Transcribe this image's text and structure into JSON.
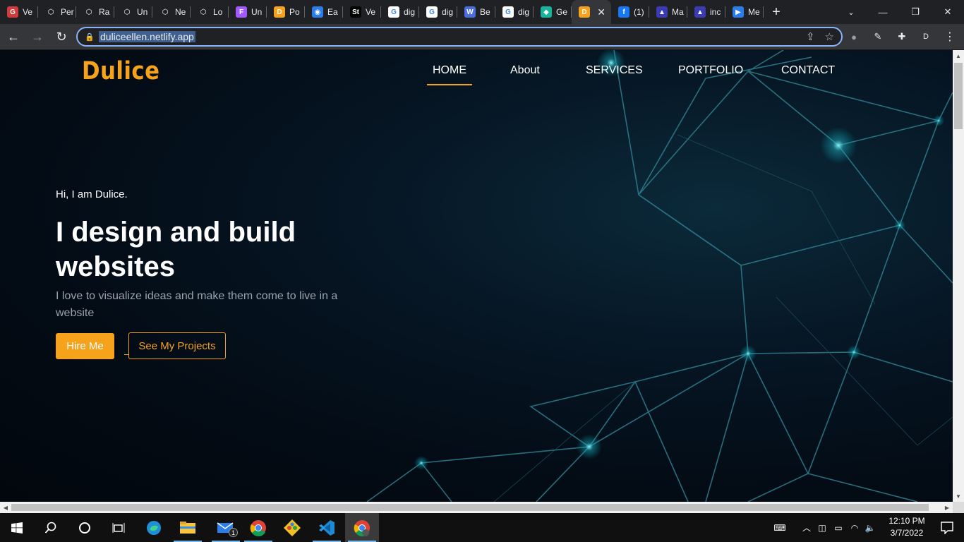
{
  "browser": {
    "tabs": [
      {
        "label": "Ve",
        "icon": "grammarly-icon",
        "color": "#d23b3b",
        "glyph": "G"
      },
      {
        "label": "Per",
        "icon": "codepen-icon",
        "color": "#202124",
        "glyph": "⬡"
      },
      {
        "label": "Ra",
        "icon": "codepen-icon",
        "color": "#202124",
        "glyph": "⬡"
      },
      {
        "label": "Un",
        "icon": "codepen-icon",
        "color": "#202124",
        "glyph": "⬡"
      },
      {
        "label": "Ne",
        "icon": "codepen-icon",
        "color": "#202124",
        "glyph": "⬡"
      },
      {
        "label": "Lo",
        "icon": "codepen-icon",
        "color": "#202124",
        "glyph": "⬡"
      },
      {
        "label": "Un",
        "icon": "figma-icon",
        "color": "#a259ff",
        "glyph": "F"
      },
      {
        "label": "Po",
        "icon": "portfolio-icon",
        "color": "#f7a21b",
        "glyph": "D"
      },
      {
        "label": "Ea",
        "icon": "bug-icon",
        "color": "#2b7de9",
        "glyph": "◉"
      },
      {
        "label": "Ve",
        "icon": "st-icon",
        "color": "#000000",
        "glyph": "St"
      },
      {
        "label": "dig",
        "icon": "google-icon",
        "color": "#ffffff",
        "glyph": "G"
      },
      {
        "label": "dig",
        "icon": "google-icon",
        "color": "#ffffff",
        "glyph": "G"
      },
      {
        "label": "Be",
        "icon": "w-icon",
        "color": "#4a6fdc",
        "glyph": "W"
      },
      {
        "label": "dig",
        "icon": "google-icon",
        "color": "#ffffff",
        "glyph": "G"
      },
      {
        "label": "Ge",
        "icon": "diamond-icon",
        "color": "#17b39a",
        "glyph": "◆"
      },
      {
        "label": "",
        "icon": "portfolio-icon",
        "color": "#f7a21b",
        "glyph": "D",
        "active": true
      },
      {
        "label": "(1)",
        "icon": "facebook-icon",
        "color": "#1877f2",
        "glyph": "f"
      },
      {
        "label": "Ma",
        "icon": "ai-icon",
        "color": "#3b3bb3",
        "glyph": "▲"
      },
      {
        "label": "inc",
        "icon": "ai-icon",
        "color": "#3b3bb3",
        "glyph": "▲"
      },
      {
        "label": "Me",
        "icon": "meet-icon",
        "color": "#2b7de9",
        "glyph": "▶"
      }
    ],
    "url": "duliceellen.netlify.app",
    "profile_letter": "D"
  },
  "site": {
    "logo": "Dulice",
    "nav": [
      {
        "label": "HOME",
        "active": true
      },
      {
        "label": "About"
      },
      {
        "label": "SERVICES"
      },
      {
        "label": "PORTFOLIO"
      },
      {
        "label": "CONTACT"
      }
    ],
    "greeting": "Hi, I am Dulice.",
    "headline": "I design and build websites",
    "subtitle": "I love to visualize ideas and make them come to live in a website",
    "hire_button": "Hire Me",
    "projects_button": "See My Projects",
    "accent_color": "#f7a21b"
  },
  "taskbar": {
    "time": "12:10 PM",
    "date": "3/7/2022",
    "mail_badge": "1"
  }
}
